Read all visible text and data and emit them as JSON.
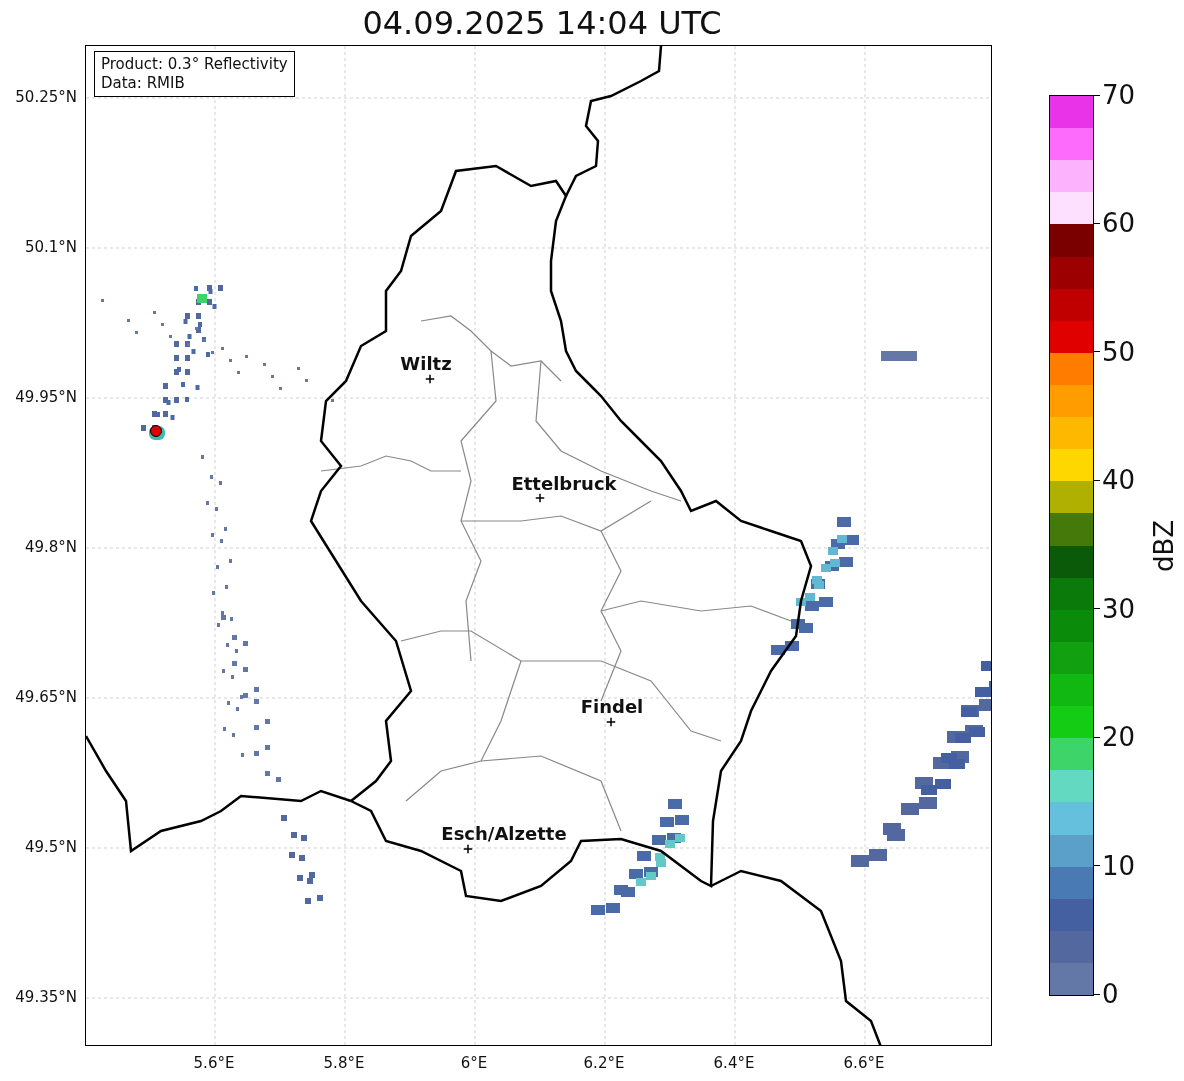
{
  "title": "04.09.2025 14:04 UTC",
  "info_box": [
    "Product: 0.3° Reflectivity",
    "Data: RMIB"
  ],
  "y_ticks": [
    "50.25°N",
    "50.1°N",
    "49.95°N",
    "49.8°N",
    "49.65°N",
    "49.5°N",
    "49.35°N"
  ],
  "x_ticks": [
    "5.6°E",
    "5.8°E",
    "6°E",
    "6.2°E",
    "6.4°E",
    "6.6°E"
  ],
  "cities": [
    {
      "name": "Wiltz"
    },
    {
      "name": "Ettelbruck"
    },
    {
      "name": "Findel"
    },
    {
      "name": "Esch/Alzette"
    }
  ],
  "colorbar": {
    "label": "dBZ",
    "ticks": [
      "70",
      "60",
      "50",
      "40",
      "30",
      "20",
      "10",
      "0"
    ],
    "segments": [
      {
        "color": "#e933e9"
      },
      {
        "color": "#fd6bfd"
      },
      {
        "color": "#fdb2fd"
      },
      {
        "color": "#fde0fd"
      },
      {
        "color": "#7a0000"
      },
      {
        "color": "#9c0000"
      },
      {
        "color": "#c00000"
      },
      {
        "color": "#e00000"
      },
      {
        "color": "#ff7c00"
      },
      {
        "color": "#ff9c00"
      },
      {
        "color": "#ffb800"
      },
      {
        "color": "#ffd700"
      },
      {
        "color": "#b0b000"
      },
      {
        "color": "#457a0a"
      },
      {
        "color": "#0a5a0a"
      },
      {
        "color": "#0a7a0a"
      },
      {
        "color": "#0a8c0a"
      },
      {
        "color": "#10a010"
      },
      {
        "color": "#12b812"
      },
      {
        "color": "#14cc14"
      },
      {
        "color": "#3dd56a"
      },
      {
        "color": "#62d9c0"
      },
      {
        "color": "#64c0dc"
      },
      {
        "color": "#5aa0c8"
      },
      {
        "color": "#4a7ab4"
      },
      {
        "color": "#4560a0"
      },
      {
        "color": "#5468a0"
      },
      {
        "color": "#6478a8"
      }
    ]
  }
}
